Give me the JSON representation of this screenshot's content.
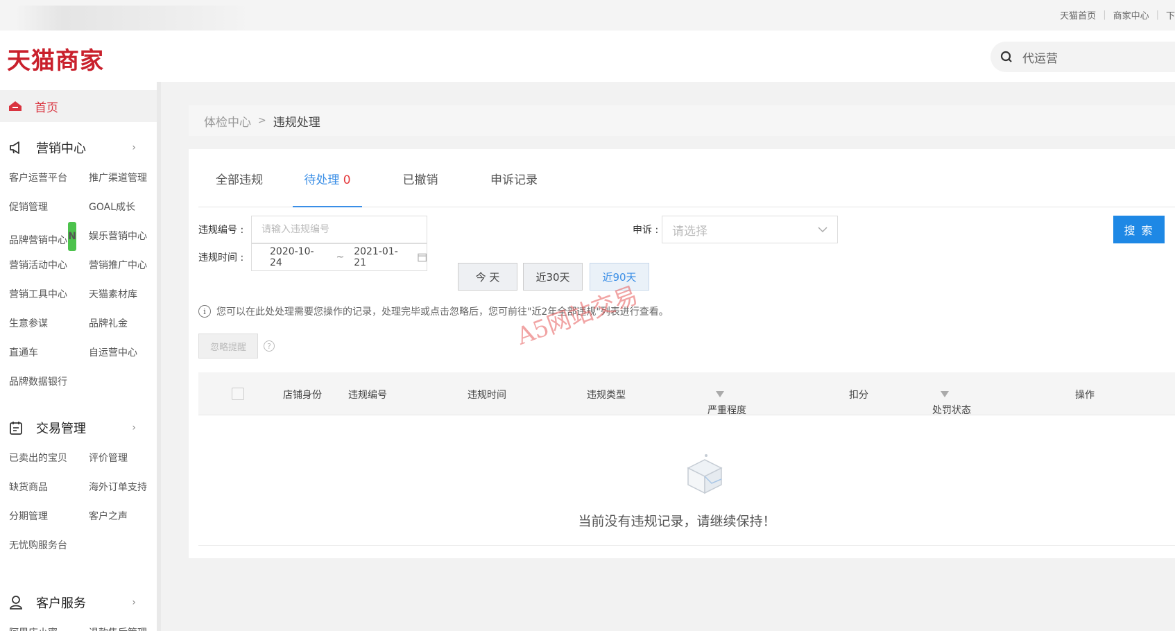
{
  "top_links": [
    "天猫首页",
    "商家中心",
    "下"
  ],
  "header": {
    "logo": "天猫商家",
    "search_value": "代运营"
  },
  "sidebar": {
    "home": "首页",
    "sections": [
      {
        "title": "营销中心",
        "items": [
          "客户运营平台",
          "推广渠道管理",
          "促销管理",
          "GOAL成长",
          "品牌营销中心",
          "娱乐营销中心",
          "营销活动中心",
          "营销推广中心",
          "营销工具中心",
          "天猫素材库",
          "生意参谋",
          "品牌礼金",
          "直通车",
          "自运营中心",
          "品牌数据银行"
        ]
      },
      {
        "title": "交易管理",
        "items": [
          "已卖出的宝贝",
          "评价管理",
          "缺货商品",
          "海外订单支持",
          "分期管理",
          "客户之声",
          "无忧购服务台"
        ]
      },
      {
        "title": "客户服务",
        "items": [
          "阿里店小蜜",
          "退款售后管理"
        ]
      }
    ],
    "new_badge": "N"
  },
  "breadcrumb": {
    "parent": "体检中心",
    "separator": ">",
    "current": "违规处理"
  },
  "tabs": [
    {
      "label": "全部违规",
      "count": ""
    },
    {
      "label": "待处理",
      "count": "0"
    },
    {
      "label": "已撤销",
      "count": ""
    },
    {
      "label": "申诉记录",
      "count": ""
    }
  ],
  "filters": {
    "violation_no_label": "违规编号 :",
    "violation_no_placeholder": "请输入违规编号",
    "appeal_label": "申诉 :",
    "appeal_placeholder": "请选择",
    "search_button": "搜 索",
    "time_label": "违规时间 :",
    "date_start": "2020-10-24",
    "date_sep": "~",
    "date_end": "2021-01-21",
    "quick": [
      "今 天",
      "近30天",
      "近90天"
    ]
  },
  "notice": "您可以在此处处理需要您操作的记录，处理完毕或点击忽略后，您可前往\"近2年全部违规\"列表进行查看。",
  "ignore_button": "忽略提醒",
  "help_mark": "?",
  "table": {
    "columns": [
      "店铺身份",
      "违规编号",
      "违规时间",
      "违规类型",
      "严重程度",
      "扣分",
      "处罚状态",
      "操作"
    ]
  },
  "empty_text": "当前没有违规记录，请继续保持！",
  "watermark": "A5网站交易",
  "colors": {
    "brand_red": "#c9202c",
    "primary_blue": "#1e88e5",
    "tab_active": "#3a8ee6"
  }
}
